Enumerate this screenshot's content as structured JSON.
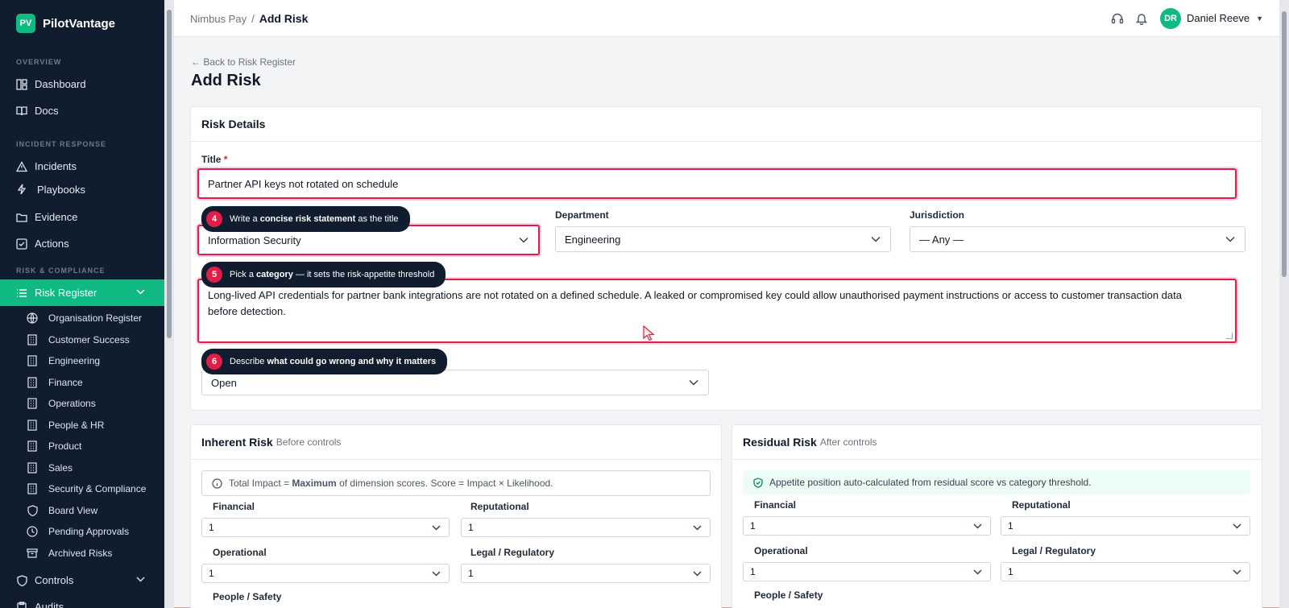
{
  "brand": {
    "logo": "PV",
    "name": "PilotVantage"
  },
  "sidebar": {
    "overview_label": "OVERVIEW",
    "overview_items": [
      {
        "label": "Dashboard",
        "icon": "dashboard-icon"
      },
      {
        "label": "Docs",
        "icon": "book-icon"
      }
    ],
    "incident_label": "INCIDENT RESPONSE",
    "incident_items": [
      {
        "label": "Incidents",
        "icon": "warning-icon"
      },
      {
        "label": "Playbooks",
        "icon": "bolt-icon"
      },
      {
        "label": "Evidence",
        "icon": "folder-icon"
      },
      {
        "label": "Actions",
        "icon": "checkbox-icon"
      }
    ],
    "risk_label": "RISK & COMPLIANCE",
    "risk_register": "Risk Register",
    "risk_sub": [
      "Organisation Register",
      "Customer Success",
      "Engineering",
      "Finance",
      "Operations",
      "People & HR",
      "Product",
      "Sales",
      "Security & Compliance",
      "Board View",
      "Pending Approvals",
      "Archived Risks"
    ],
    "controls": "Controls",
    "audits": "Audits"
  },
  "topbar": {
    "crumb_parent": "Nimbus Pay",
    "crumb_sep": "/",
    "crumb_current": "Add Risk",
    "avatar": "DR",
    "user_name": "Daniel Reeve"
  },
  "page": {
    "back_link": "← Back to Risk Register",
    "title": "Add Risk"
  },
  "details": {
    "heading": "Risk Details",
    "title_label": "Title",
    "title_required": "*",
    "title_value": "Partner API keys not rotated on schedule",
    "category_value": "Information Security",
    "department_label": "Department",
    "department_value": "Engineering",
    "jurisdiction_label": "Jurisdiction",
    "jurisdiction_value": "— Any —",
    "description_value": "Long-lived API credentials for partner bank integrations are not rotated on a defined schedule. A leaked or compromised key could allow unauthorised payment instructions or access to customer transaction data before detection.",
    "status_value": "Open"
  },
  "tips": [
    {
      "num": "4",
      "pre": "Write a ",
      "bold": "concise risk statement",
      "post": " as the title"
    },
    {
      "num": "5",
      "pre": "Pick a ",
      "bold": "category",
      "post": " — it sets the risk-appetite threshold"
    },
    {
      "num": "6",
      "pre": "Describe ",
      "bold": "what could go wrong and why it matters",
      "post": ""
    }
  ],
  "inherent": {
    "heading": "Inherent Risk",
    "sub": "Before controls",
    "info_pre": "Total Impact = ",
    "info_bold": "Maximum",
    "info_post": " of dimension scores. Score = Impact × Likelihood.",
    "financial_label": "Financial",
    "financial": "1",
    "reputational_label": "Reputational",
    "reputational": "1",
    "operational_label": "Operational",
    "operational": "1",
    "legal_label": "Legal / Regulatory",
    "legal": "1",
    "people_label": "People / Safety"
  },
  "residual": {
    "heading": "Residual Risk",
    "sub": "After controls",
    "info": "Appetite position auto-calculated from residual score vs category threshold.",
    "financial_label": "Financial",
    "financial": "1",
    "reputational_label": "Reputational",
    "reputational": "1",
    "operational_label": "Operational",
    "operational": "1",
    "legal_label": "Legal / Regulatory",
    "legal": "1",
    "people_label": "People / Safety"
  },
  "colors": {
    "accent": "#10b981",
    "sidebar": "#0f1d2e",
    "highlight": "#e11d48"
  }
}
